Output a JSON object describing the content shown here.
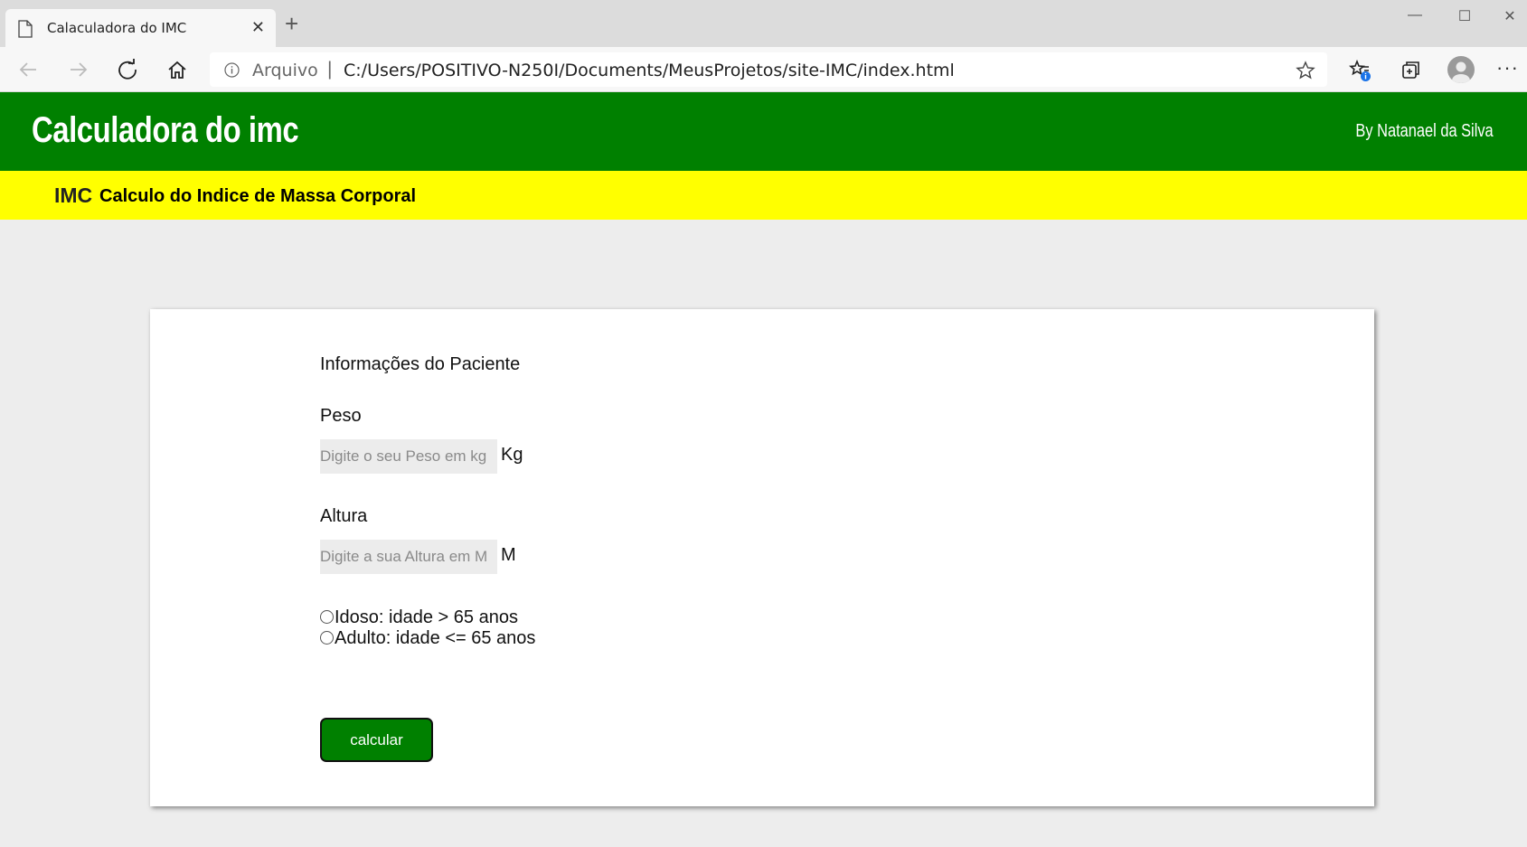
{
  "browser": {
    "tab_title": "Calaculadora do IMC",
    "tab_close": "✕",
    "new_tab": "+",
    "window_controls": {
      "minimize": "—",
      "maximize": "☐",
      "close": "✕"
    },
    "address": {
      "label": "Arquivo",
      "separator": "|",
      "url": "C:/Users/POSITIVO-N250I/Documents/MeusProjetos/site-IMC/index.html"
    },
    "more": "···"
  },
  "header": {
    "title": "Calculadora do imc",
    "author": "By Natanael da Silva",
    "color": "#008000"
  },
  "subheader": {
    "abbr": "IMC",
    "text": "Calculo do Indice de Massa Corporal",
    "color": "#ffff00"
  },
  "form": {
    "title": "Informações do Paciente",
    "peso": {
      "label": "Peso",
      "placeholder": "Digite o seu Peso em kg",
      "unit": "Kg"
    },
    "altura": {
      "label": "Altura",
      "placeholder": "Digite a sua Altura em M",
      "unit": "M"
    },
    "options": [
      {
        "label": "Idoso: idade > 65 anos"
      },
      {
        "label": "Adulto: idade <= 65 anos"
      }
    ],
    "button_label": "calcular"
  }
}
